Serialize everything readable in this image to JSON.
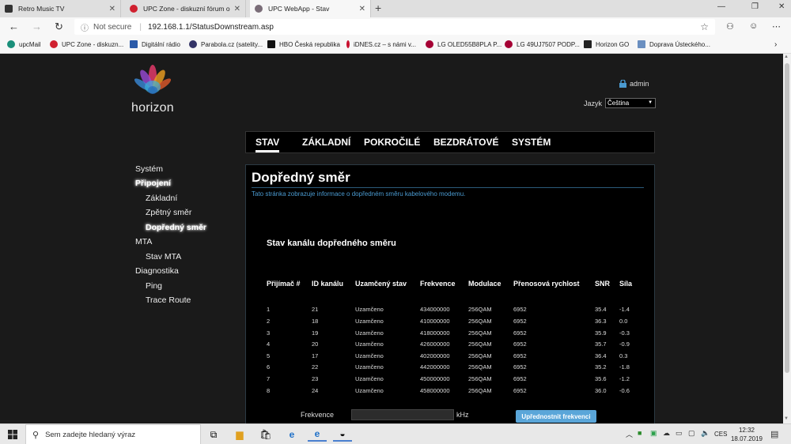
{
  "browser": {
    "tabs": [
      {
        "label": "Retro Music TV",
        "color": "#333333",
        "active": false
      },
      {
        "label": "UPC Zone - diskuzní fórum o UPC",
        "color": "#d0202f",
        "active": false
      },
      {
        "label": "UPC WebApp - Stav",
        "color": "#7a6d78",
        "active": true
      }
    ],
    "address": {
      "security": "Not secure",
      "url": "192.168.1.1/StatusDownstream.asp"
    },
    "favorites": [
      {
        "label": "upcMail",
        "color": "#1a8f7a"
      },
      {
        "label": "UPC Zone - diskuzn...",
        "color": "#d0202f"
      },
      {
        "label": "Digitální rádio",
        "color": "#2a5aa8"
      },
      {
        "label": "Parabola.cz (satelity...",
        "color": "#333366"
      },
      {
        "label": "HBO Česká republika",
        "color": "#111111"
      },
      {
        "label": "iDNES.cz – s námi v...",
        "color": "#c8102e"
      },
      {
        "label": "LG OLED55B8PLA P...",
        "color": "#a50034"
      },
      {
        "label": "LG 49UJ7507 PODP...",
        "color": "#a50034"
      },
      {
        "label": "Horizon GO",
        "color": "#222222"
      },
      {
        "label": "Doprava Ústeckého...",
        "color": "#6a8fc0"
      }
    ]
  },
  "header": {
    "logo_text": "horizon",
    "user": "admin",
    "language_label": "Jazyk",
    "language_value": "Čeština"
  },
  "nav": {
    "items": [
      "STAV",
      "ZÁKLADNÍ",
      "POKROČILÉ",
      "BEZDRÁTOVÉ",
      "SYSTÉM"
    ],
    "active": "STAV"
  },
  "sidebar": {
    "items": [
      {
        "label": "Systém",
        "level": 0,
        "active": false
      },
      {
        "label": "Připojení",
        "level": 0,
        "active": true
      },
      {
        "label": "Základní",
        "level": 1,
        "active": false
      },
      {
        "label": "Zpětný směr",
        "level": 1,
        "active": false
      },
      {
        "label": "Dopředný směr",
        "level": 1,
        "active": true
      },
      {
        "label": "MTA",
        "level": 0,
        "active": false
      },
      {
        "label": "Stav MTA",
        "level": 1,
        "active": false
      },
      {
        "label": "Diagnostika",
        "level": 0,
        "active": false
      },
      {
        "label": "Ping",
        "level": 1,
        "active": false
      },
      {
        "label": "Trace Route",
        "level": 1,
        "active": false
      }
    ]
  },
  "content": {
    "title": "Dopředný směr",
    "description": "Tato stránka zobrazuje informace o dopředném směru kabelového modemu.",
    "table_title": "Stav kanálu dopředného směru",
    "columns": [
      "Přijímač #",
      "ID kanálu",
      "Uzamčený stav",
      "Frekvence",
      "Modulace",
      "Přenosová rychlost",
      "SNR",
      "Síla"
    ],
    "rows": [
      [
        "1",
        "21",
        "Uzamčeno",
        "434000000",
        "256QAM",
        "6952",
        "35.4",
        "-1.4"
      ],
      [
        "2",
        "18",
        "Uzamčeno",
        "410000000",
        "256QAM",
        "6952",
        "36.3",
        "0.0"
      ],
      [
        "3",
        "19",
        "Uzamčeno",
        "418000000",
        "256QAM",
        "6952",
        "35.9",
        "-0.3"
      ],
      [
        "4",
        "20",
        "Uzamčeno",
        "426000000",
        "256QAM",
        "6952",
        "35.7",
        "-0.9"
      ],
      [
        "5",
        "17",
        "Uzamčeno",
        "402000000",
        "256QAM",
        "6952",
        "36.4",
        "0.3"
      ],
      [
        "6",
        "22",
        "Uzamčeno",
        "442000000",
        "256QAM",
        "6952",
        "35.2",
        "-1.8"
      ],
      [
        "7",
        "23",
        "Uzamčeno",
        "450000000",
        "256QAM",
        "6952",
        "35.6",
        "-1.2"
      ],
      [
        "8",
        "24",
        "Uzamčeno",
        "458000000",
        "256QAM",
        "6952",
        "36.0",
        "-0.6"
      ]
    ],
    "freq_label": "Frekvence",
    "freq_value": "",
    "freq_unit": "kHz",
    "freq_button": "Upřednostnit frekvenci"
  },
  "taskbar": {
    "search_placeholder": "Sem zadejte hledaný výraz",
    "language": "CES",
    "time": "12:32",
    "date": "18.07.2019"
  },
  "colors": {
    "accent": "#5aa6d9",
    "page_bg": "#1a1a1a",
    "content_bg": "#000000",
    "link_blue": "#4a9ad0"
  }
}
